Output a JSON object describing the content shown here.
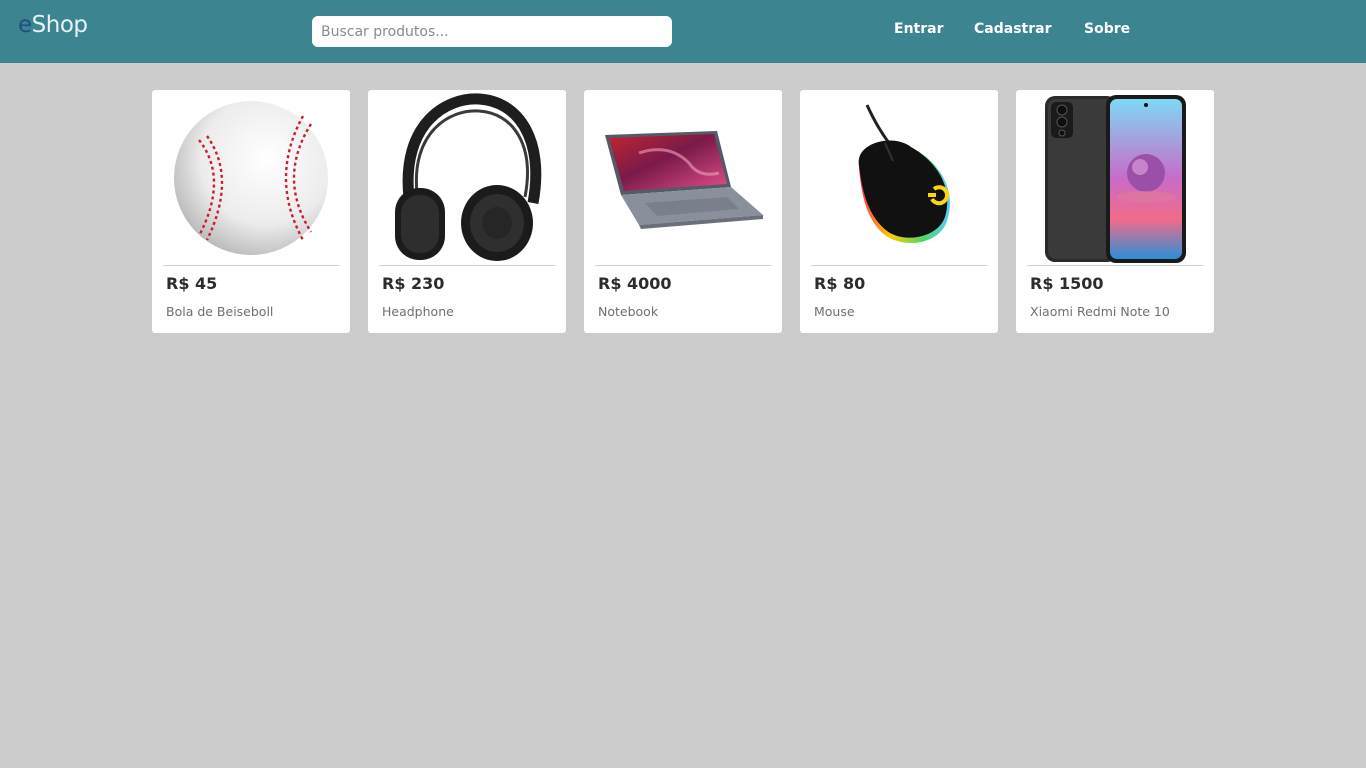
{
  "header": {
    "logo_first": "e",
    "logo_rest": "Shop",
    "search_placeholder": "Buscar produtos...",
    "nav": [
      "Entrar",
      "Cadastrar",
      "Sobre"
    ]
  },
  "products": [
    {
      "price": "R$ 45",
      "name": "Bola de Beiseboll",
      "icon": "baseball-icon"
    },
    {
      "price": "R$ 230",
      "name": "Headphone",
      "icon": "headphone-icon"
    },
    {
      "price": "R$ 4000",
      "name": "Notebook",
      "icon": "laptop-icon"
    },
    {
      "price": "R$ 80",
      "name": "Mouse",
      "icon": "mouse-icon"
    },
    {
      "price": "R$ 1500",
      "name": "Xiaomi Redmi Note 10",
      "icon": "smartphone-icon"
    }
  ],
  "colors": {
    "header_bg": "#3d8491",
    "page_bg": "#cccccc",
    "logo_e": "#1f4f82"
  }
}
